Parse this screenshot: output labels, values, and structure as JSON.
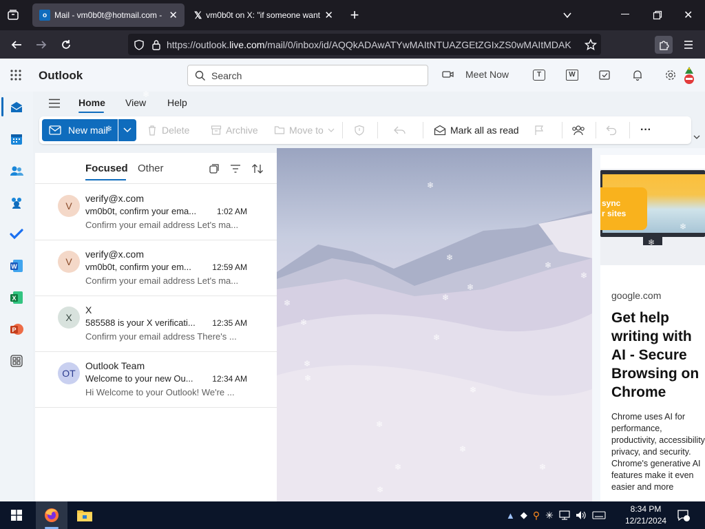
{
  "browser": {
    "tabs": [
      {
        "title": "Mail - vm0b0t@hotmail.com - ",
        "active": true
      },
      {
        "title": "vm0b0t on X: \"if someone want",
        "active": false
      }
    ],
    "new_tab_symbol": "+",
    "url_prefix": "https://outlook.",
    "url_domain": "live.com",
    "url_rest": "/mail/0/inbox/id/AQQkADAwATYwMAItNTUAZGEtZGIxZS0wMAItMDAK"
  },
  "outlook": {
    "app_name": "Outlook",
    "search_placeholder": "Search",
    "meet_now_label": "Meet Now",
    "ribbon_tabs": [
      "Home",
      "View",
      "Help"
    ],
    "toolbar": {
      "new_mail": "New mail",
      "delete": "Delete",
      "archive": "Archive",
      "move_to": "Move to",
      "mark_all_read": "Mark all as read",
      "more": "···"
    },
    "pivots": {
      "focused": "Focused",
      "other": "Other"
    },
    "messages": [
      {
        "initials": "V",
        "sender": "verify@x.com",
        "subject": "vm0b0t, confirm your ema...",
        "time": "1:02 AM",
        "preview": "Confirm your email address Let's ma...",
        "avatar_bg": "#f4d8c8",
        "avatar_fg": "#8a4b2a"
      },
      {
        "initials": "V",
        "sender": "verify@x.com",
        "subject": "vm0b0t, confirm your em...",
        "time": "12:59 AM",
        "preview": "Confirm your email address Let's ma...",
        "avatar_bg": "#f4d8c8",
        "avatar_fg": "#8a4b2a"
      },
      {
        "initials": "X",
        "sender": "X",
        "subject": "585588 is your X verificati...",
        "time": "12:35 AM",
        "preview": "Confirm your email address There's ...",
        "avatar_bg": "#d8e2dd",
        "avatar_fg": "#3a4a44"
      },
      {
        "initials": "OT",
        "sender": "Outlook Team",
        "subject": "Welcome to your new Ou...",
        "time": "12:34 AM",
        "preview": "Hi Welcome to your Outlook! We're ...",
        "avatar_bg": "#c9d0f0",
        "avatar_fg": "#2b3b8f"
      }
    ],
    "ad": {
      "image_text": "sync\nr sites",
      "domain": "google.com",
      "headline": "Get help writing with AI - Secure Browsing on Chrome",
      "body": "Chrome uses AI for performance, productivity, accessibility, privacy, and security. Chrome's generative AI features make it even easier and more"
    }
  },
  "taskbar": {
    "time": "8:34 PM",
    "date": "12/21/2024"
  },
  "colors": {
    "accent": "#0f6cbd",
    "browser_bg": "#1c1b22",
    "taskbar_bg": "#0b1529"
  }
}
